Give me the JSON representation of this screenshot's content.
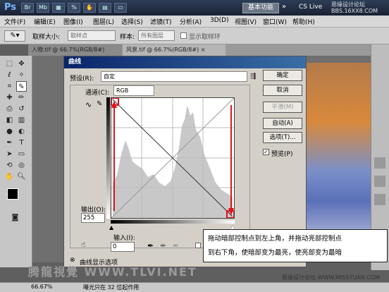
{
  "titlebar": {
    "app_logo": "Ps",
    "workspace_button": "基本功能",
    "cslive": "CS Live",
    "watermark_top": "思缘设计论坛 BBS.16XX8.COM"
  },
  "menu": [
    "文件(F)",
    "编辑(E)",
    "图像(I)",
    "图层(L)",
    "选择(S)",
    "滤镜(T)",
    "分析(A)",
    "3D(D)",
    "视图(V)",
    "窗口(W)",
    "帮助(H)"
  ],
  "options": {
    "sample_size_label": "取样大小:",
    "sample_size_value": "取样点",
    "sample_label": "样本:",
    "sample_value": "所有图层",
    "show_ring_label": "显示取样环"
  },
  "tabs": [
    {
      "label": "人物.tif @ 66.7%(RGB/8#)"
    },
    {
      "label": "风景.tif @ 66.7%(RGB/8#)"
    }
  ],
  "dialog": {
    "title": "曲线",
    "preset_label": "预设(R):",
    "preset_value": "自定",
    "channel_label": "通道(C):",
    "channel_value": "RGB",
    "output_label": "输出(O):",
    "output_value": "255",
    "input_label": "输入(I):",
    "input_value": "0",
    "buttons": {
      "ok": "确定",
      "cancel": "取消",
      "smooth": "平滑(M)",
      "auto": "自动(A)",
      "options": "选项(T)..."
    },
    "preview_label": "预览(P)",
    "curve_display_label": "曲线显示选项"
  },
  "callout": {
    "line1": "拖动暗部控制点到左上角，并拖动亮部控制点",
    "line2": "到右下角，使暗部变为最亮，使亮部变为最暗"
  },
  "status": {
    "zoom": "66.67%",
    "info": "曝光只在 32 位起作用"
  },
  "watermarks": {
    "bottom_left": "腾龍視覺 WWW.TLVI.NET",
    "bottom_right": "思缘设计论坛 WWW.MISSYUAN.COM"
  },
  "colors": {
    "accent_red": "#e0141e",
    "titlebar_blue": "#0a246a"
  }
}
